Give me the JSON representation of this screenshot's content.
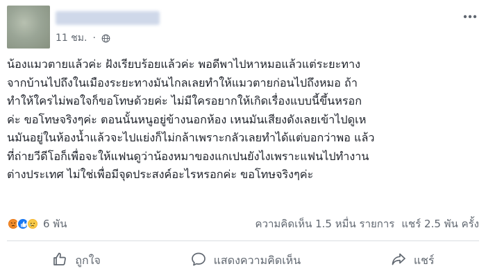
{
  "post": {
    "time": "11 ชม.",
    "dot": "·",
    "text_lines": [
      "น้องแมวตายแล้วค่ะ ฝังเรียบร้อยแล้วค่ะ พอดีพาไปหาหมอแล้วแต่ระยะทาง",
      "จากบ้านไปถึงในเมืองระยะทางมันไกลเลยทำให้แมวตายก่อนไปถึงหมอ ถ้า",
      "ทำให้ใครไม่พอใจก็ขอโทษด้วยค่ะ ไม่มีใครอยากให้เกิดเรื่องแบบนี้ขึ้นหรอก",
      "ค่ะ ขอโทษจริงๆค่ะ ตอนนั้นหนูอยู่ข้างนอกห้อง เหนมันเสียงดังเลยเข้าไปดูเห",
      "นมันอยู่ในห้องน้ำแล้วจะไปแย่งก็ไม่กล้าเพราะกลัวเลยทำได้แต่บอกว่าพอ แล้ว",
      "ที่ถ่ายวีดีโอก็เพื่อจะให้แฟนดูว่าน้องหมาของแกเปนยังไงเพราะแฟนไปทำงาน",
      "ต่างประเทศ ไม่ใช่เพื่อมีจุดประสงค์อะไรหรอกค่ะ ขอโทษจริงๆค่ะ"
    ]
  },
  "stats": {
    "reactions_count": "6 พัน",
    "comments": "ความคิดเห็น 1.5 หมื่น รายการ",
    "shares": "แชร์ 2.5 พัน ครั้ง",
    "reaction_icons": [
      "angry-icon",
      "like-icon",
      "sad-icon"
    ]
  },
  "actions": {
    "like": "ถูกใจ",
    "comment": "แสดงความคิดเห็น",
    "share": "แชร์"
  },
  "colors": {
    "text": "#1d2129",
    "secondary": "#606770",
    "divider": "#dadde1",
    "like_blue": "#1877f2",
    "angry": "#e9710f",
    "sad": "#f7b125"
  }
}
